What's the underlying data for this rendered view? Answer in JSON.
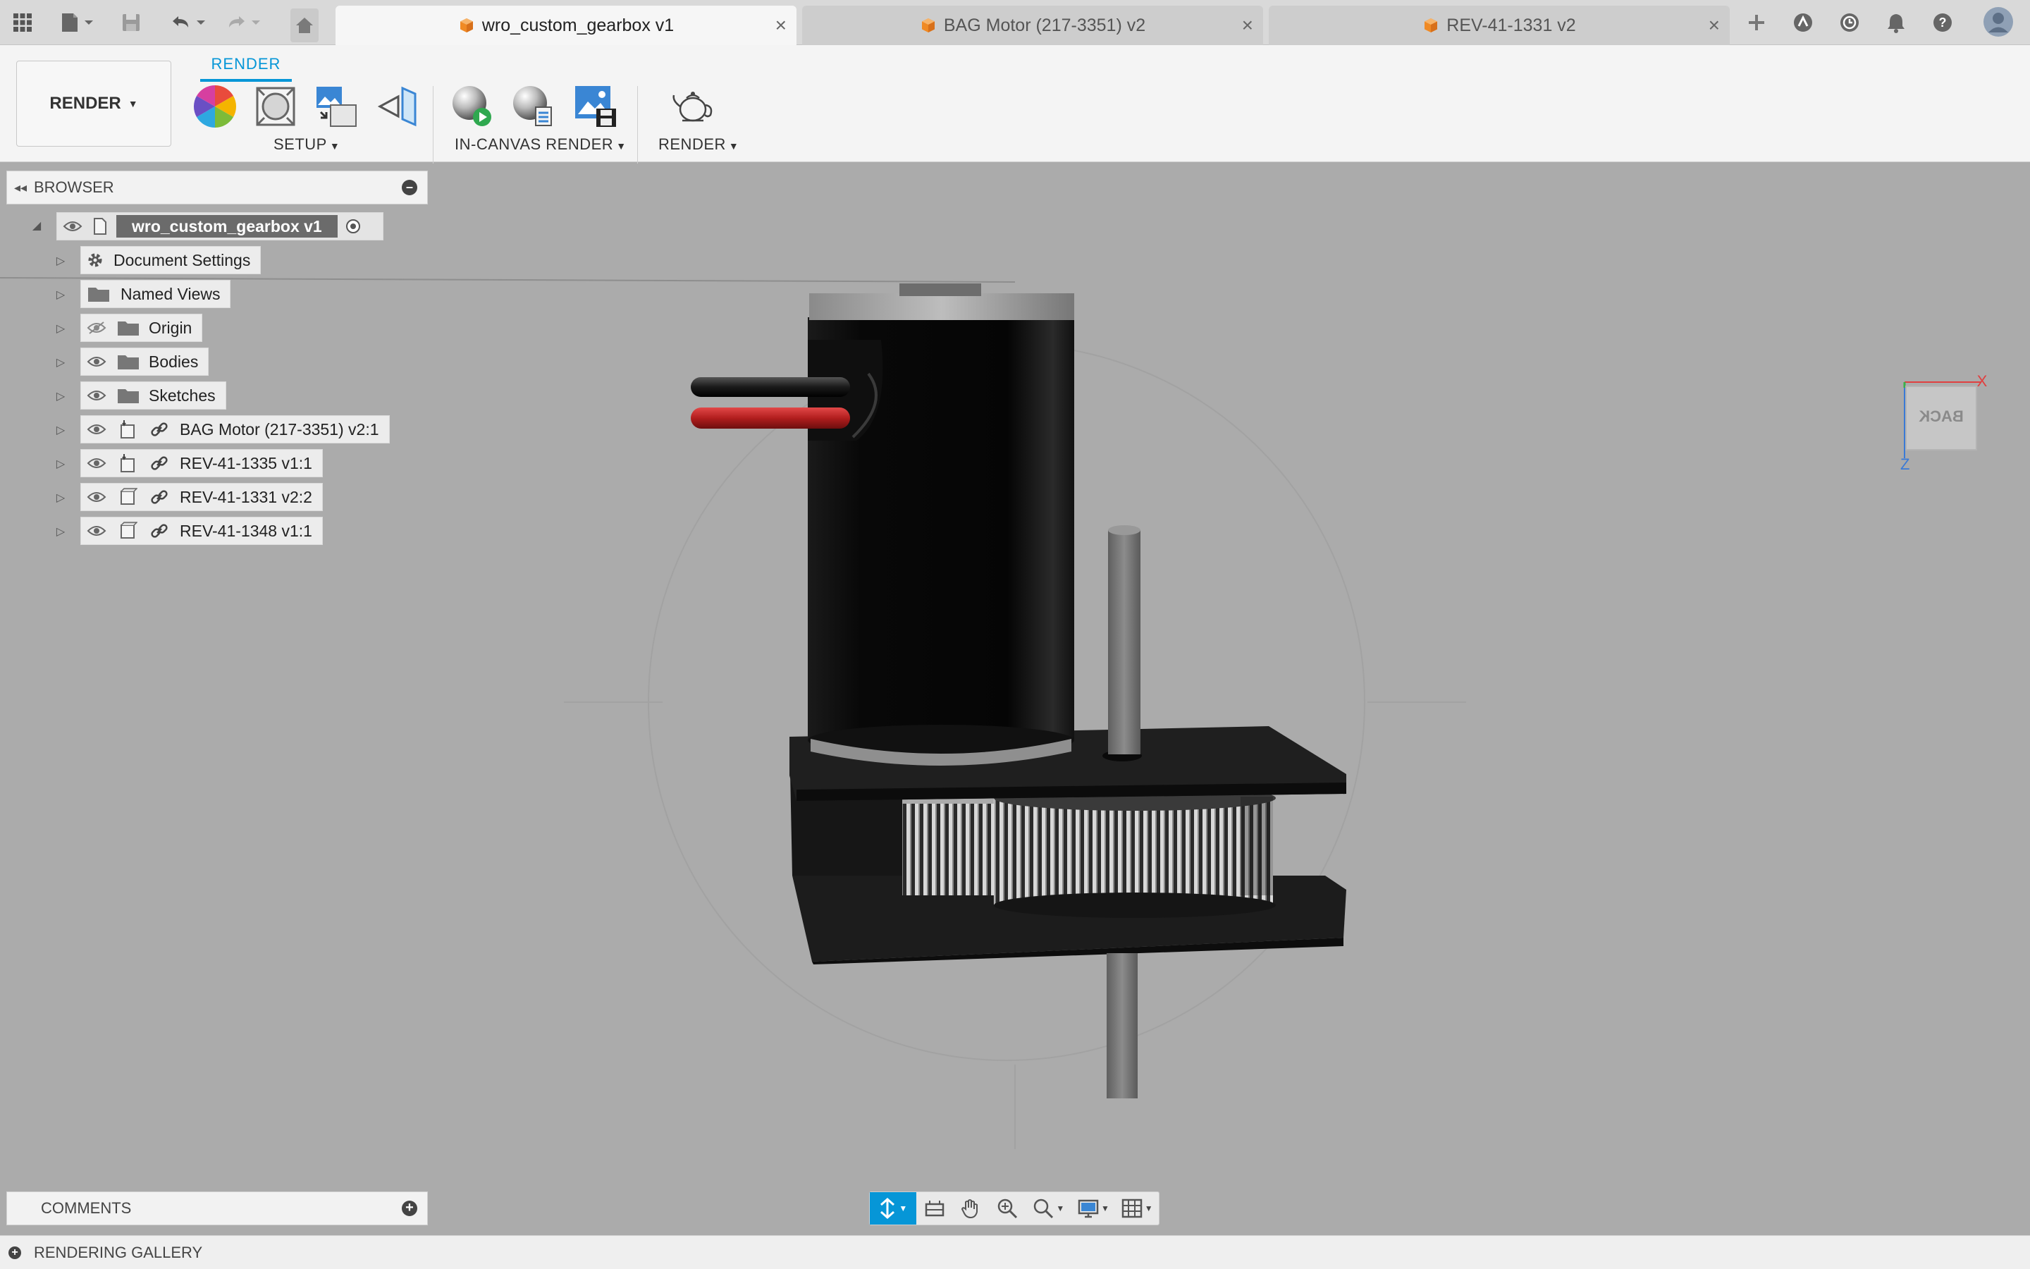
{
  "tabs": [
    {
      "label": "wro_custom_gearbox v1",
      "active": true
    },
    {
      "label": "BAG Motor (217-3351) v2",
      "active": false
    },
    {
      "label": "REV-41-1331 v2",
      "active": false
    }
  ],
  "toolbar_icons": [
    "apps-grid-icon",
    "file-icon",
    "save-icon",
    "undo-icon",
    "redo-icon",
    "home-icon",
    "new-tab-icon",
    "extensions-icon",
    "job-status-icon",
    "notifications-icon",
    "help-icon",
    "user-avatar"
  ],
  "ribbon": {
    "workspace": "RENDER",
    "active_tab": "RENDER",
    "groups": {
      "setup": "SETUP",
      "in_canvas": "IN-CANVAS RENDER",
      "render": "RENDER"
    }
  },
  "browser": {
    "title": "BROWSER",
    "root": "wro_custom_gearbox v1",
    "items": [
      {
        "label": "Document Settings",
        "icon": "gear-icon"
      },
      {
        "label": "Named Views",
        "icon": "folder-icon"
      },
      {
        "label": "Origin",
        "icon": "folder-icon",
        "visibility": "hidden"
      },
      {
        "label": "Bodies",
        "icon": "folder-icon",
        "visibility": "visible"
      },
      {
        "label": "Sketches",
        "icon": "folder-icon",
        "visibility": "visible"
      },
      {
        "label": "BAG Motor (217-3351) v2:1",
        "icon": "component-icon",
        "linked": true
      },
      {
        "label": "REV-41-1335 v1:1",
        "icon": "component-icon",
        "linked": true
      },
      {
        "label": "REV-41-1331 v2:2",
        "icon": "component-icon",
        "linked": true
      },
      {
        "label": "REV-41-1348 v1:1",
        "icon": "component-icon",
        "linked": true
      }
    ]
  },
  "viewcube": {
    "face": "BACK",
    "axis_x": "X",
    "axis_z": "Z"
  },
  "comments": {
    "title": "COMMENTS"
  },
  "gallery": {
    "title": "RENDERING GALLERY"
  },
  "colors": {
    "accent": "#0696d7",
    "viewport_bg": "#ababab",
    "tab_orange": "#f08a24"
  }
}
